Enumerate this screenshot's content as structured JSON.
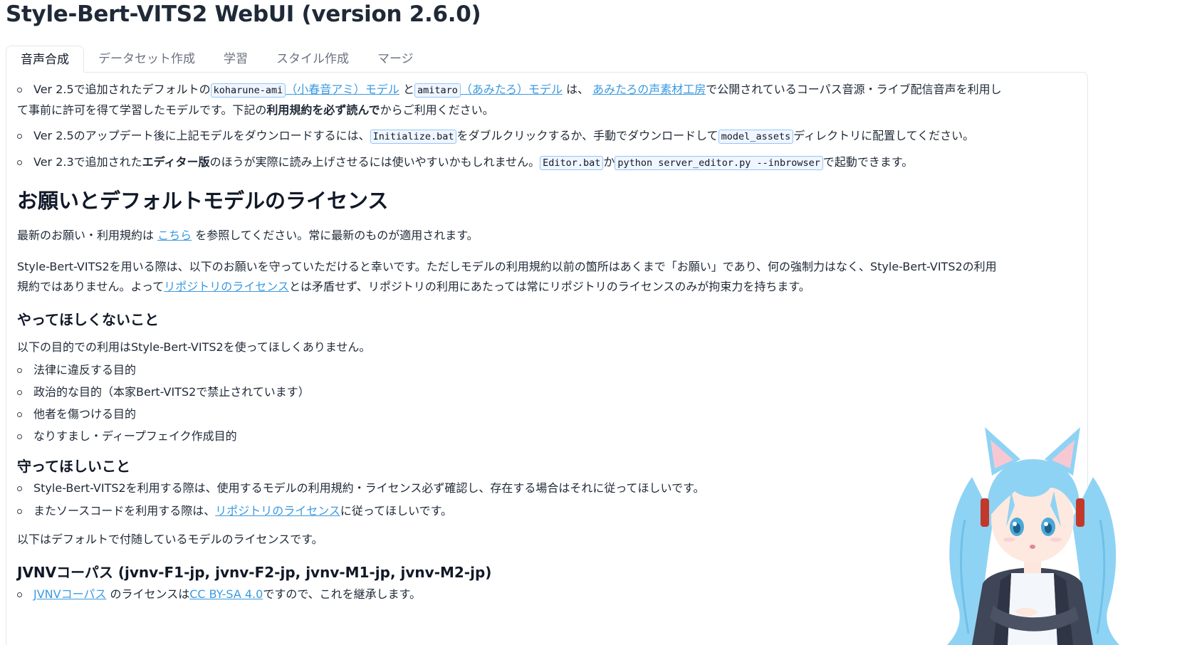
{
  "app": {
    "title": "Style-Bert-VITS2 WebUI (version 2.6.0)"
  },
  "tabs": [
    {
      "label": "音声合成",
      "active": true
    },
    {
      "label": "データセット作成",
      "active": false
    },
    {
      "label": "学習",
      "active": false
    },
    {
      "label": "スタイル作成",
      "active": false
    },
    {
      "label": "マージ",
      "active": false
    }
  ],
  "intro": {
    "item1": {
      "t1": "Ver 2.5で追加されたデフォルトの",
      "code1": "koharune-ami",
      "link1": "（小春音アミ）モデル",
      "t2": "と",
      "code2": "amitaro",
      "link2": "（あみたろ）モデル",
      "t3": "は、",
      "link3": "あみたろの声素材工房",
      "t4": "で公開されているコーパス音源・ライブ配信音声を利用し",
      "t5": "て事前に許可を得て学習したモデルです。下記の",
      "bold": "利用規約を必ず読んで",
      "t6": "からご利用ください。"
    },
    "item2": {
      "t1": "Ver 2.5のアップデート後に上記モデルをダウンロードするには、",
      "code1": "Initialize.bat",
      "t2": "をダブルクリックするか、手動でダウンロードして",
      "code2": "model_assets",
      "t3": "ディレクトリに配置してください。"
    },
    "item3": {
      "t1": "Ver 2.3で追加された",
      "bold": "エディター版",
      "t2": "のほうが実際に読み上げさせるには使いやすいかもしれません。",
      "code1": "Editor.bat",
      "t3": "か",
      "code2": "python server_editor.py --inbrowser",
      "t4": "で起動できます。"
    }
  },
  "license": {
    "heading": "お願いとデフォルトモデルのライセンス",
    "p1": {
      "t1": "最新のお願い・利用規約は ",
      "link": "こちら",
      "t2": " を参照してください。常に最新のものが適用されます。"
    },
    "p2": {
      "t1": "Style-Bert-VITS2を用いる際は、以下のお願いを守っていただけると幸いです。ただしモデルの利用規約以前の箇所はあくまで「お願い」であり、何の強制力はなく、Style-Bert-VITS2の利用",
      "t2": "規約ではありません。よって",
      "link": "リポジトリのライセンス",
      "t3": "とは矛盾せず、リポジトリの利用にあたっては常にリポジトリのライセンスのみが拘束力を持ちます。"
    },
    "dont": {
      "heading": "やってほしくないこと",
      "intro": "以下の目的での利用はStyle-Bert-VITS2を使ってほしくありません。",
      "items": [
        "法律に違反する目的",
        "政治的な目的（本家Bert-VITS2で禁止されています）",
        "他者を傷つける目的",
        "なりすまし・ディープフェイク作成目的"
      ]
    },
    "do": {
      "heading": "守ってほしいこと",
      "item1": "Style-Bert-VITS2を利用する際は、使用するモデルの利用規約・ライセンス必ず確認し、存在する場合はそれに従ってほしいです。",
      "item2": {
        "t1": "またソースコードを利用する際は、",
        "link": "リポジトリのライセンス",
        "t2": "に従ってほしいです。"
      }
    },
    "default_models": "以下はデフォルトで付随しているモデルのライセンスです。",
    "jvnv": {
      "heading": "JVNVコーパス (jvnv-F1-jp, jvnv-F2-jp, jvnv-M1-jp, jvnv-M2-jp)",
      "item": {
        "link1": "JVNVコーパス",
        "t1": " のライセンスは",
        "link2": "CC BY-SA 4.0",
        "t2": "ですので、これを継承します。"
      }
    }
  },
  "colors": {
    "link": "#3b9ae1",
    "code_bg": "#eff6ff",
    "code_border": "#93c5fd",
    "hair": "#7cc8ee"
  }
}
